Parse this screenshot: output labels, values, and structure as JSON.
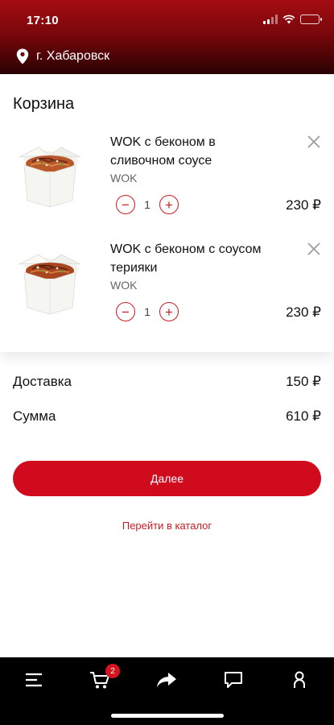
{
  "status_bar": {
    "time": "17:10"
  },
  "location": {
    "city": "г. Хабаровск"
  },
  "cart": {
    "title": "Корзина",
    "items": [
      {
        "name": "WOK с беконом в сливочном соусе",
        "category": "WOK",
        "quantity": "1",
        "price": "230 ₽"
      },
      {
        "name": "WOK с беконом с соусом терияки",
        "category": "WOK",
        "quantity": "1",
        "price": "230 ₽"
      }
    ]
  },
  "summary": {
    "delivery_label": "Доставка",
    "delivery_value": "150 ₽",
    "total_label": "Сумма",
    "total_value": "610 ₽"
  },
  "actions": {
    "next_label": "Далее",
    "catalog_link": "Перейти в каталог"
  },
  "bottom_nav": {
    "items": [
      "menu-icon",
      "cart-icon",
      "share-icon",
      "chat-icon",
      "profile-icon"
    ],
    "cart_badge": "2"
  },
  "colors": {
    "accent": "#cf0b1d",
    "header_top": "#a50d12",
    "header_bottom": "#2a0203"
  }
}
